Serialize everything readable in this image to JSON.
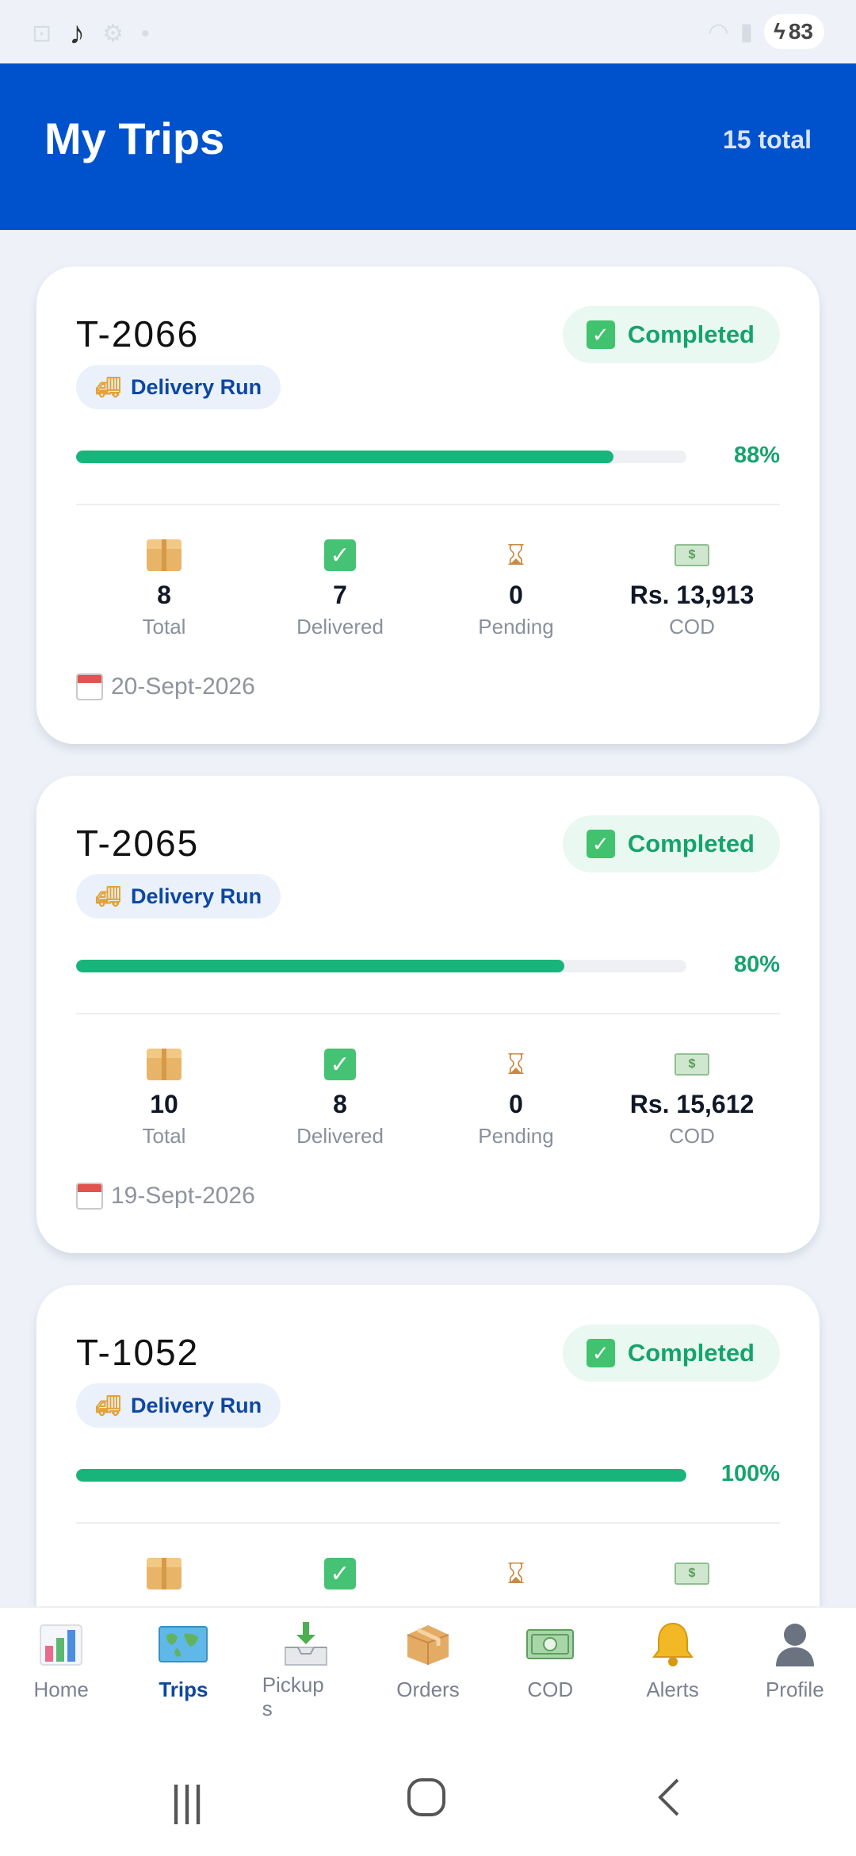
{
  "status_bar": {
    "battery": "83"
  },
  "header": {
    "title": "My Trips",
    "count": "15 total"
  },
  "trips": [
    {
      "id": "T-2066",
      "type": "Delivery Run",
      "status": "Completed",
      "progress_percent": 88,
      "progress_label": "88%",
      "stats": {
        "total": "8",
        "total_label": "Total",
        "delivered": "7",
        "delivered_label": "Delivered",
        "pending": "0",
        "pending_label": "Pending",
        "cod": "Rs. 13,913",
        "cod_label": "COD"
      },
      "date": "20-Sept-2026"
    },
    {
      "id": "T-2065",
      "type": "Delivery Run",
      "status": "Completed",
      "progress_percent": 80,
      "progress_label": "80%",
      "stats": {
        "total": "10",
        "total_label": "Total",
        "delivered": "8",
        "delivered_label": "Delivered",
        "pending": "0",
        "pending_label": "Pending",
        "cod": "Rs. 15,612",
        "cod_label": "COD"
      },
      "date": "19-Sept-2026"
    },
    {
      "id": "T-1052",
      "type": "Delivery Run",
      "status": "Completed",
      "progress_percent": 100,
      "progress_label": "100%"
    }
  ],
  "bottom_nav": {
    "items": [
      {
        "label": "Home",
        "icon": "bar-chart-icon"
      },
      {
        "label": "Trips",
        "icon": "world-map-icon"
      },
      {
        "label": "Pickup\ns",
        "icon": "inbox-tray-icon"
      },
      {
        "label": "Orders",
        "icon": "package-icon"
      },
      {
        "label": "COD",
        "icon": "banknote-icon"
      },
      {
        "label": "Alerts",
        "icon": "bell-icon"
      },
      {
        "label": "Profile",
        "icon": "user-silhouette-icon"
      }
    ],
    "active": "Trips"
  },
  "colors": {
    "header_bg": "#0052cc",
    "success_green": "#19b47c",
    "active_nav": "#0d47a1"
  }
}
